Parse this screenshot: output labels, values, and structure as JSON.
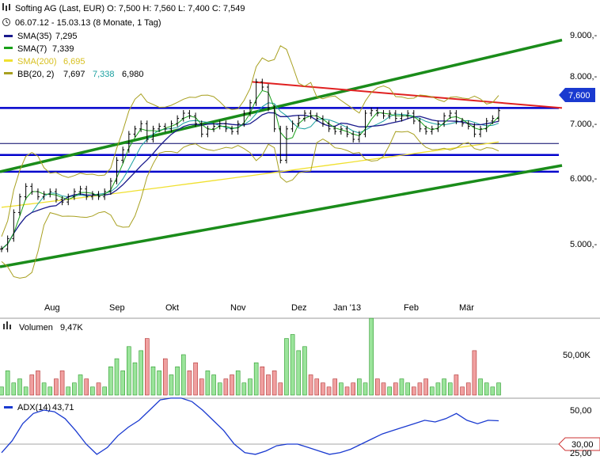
{
  "header": {
    "title_line": "Softing AG (Last, EUR)  O: 7,500  H: 7,560  L: 7,400  C: 7,549",
    "period_line": "06.07.12 - 15.03.13 (8 Monate, 1 Tag)"
  },
  "legend": {
    "sma35": {
      "label": "SMA(35)",
      "value": "7,295",
      "color": "#1a1a8c"
    },
    "sma7": {
      "label": "SMA(7)",
      "value": "7,339",
      "color": "#18a018"
    },
    "sma200": {
      "label": "SMA(200)",
      "value": "6,695",
      "color": "#f0e030"
    },
    "bb": {
      "label": "BB(20, 2)",
      "v1": "7,697",
      "v2": "7,338",
      "v3": "6,980",
      "color": "#a8a020",
      "mid_color": "#1aa0a0"
    }
  },
  "price_axis": {
    "labels": [
      "9.000,-",
      "8.000,-",
      "7.000,-",
      "6.000,-",
      "5.000,-"
    ]
  },
  "current_price_tag": "7,600",
  "time_axis": {
    "labels": [
      "Aug",
      "Sep",
      "Okt",
      "Nov",
      "Dez",
      "Jan '13",
      "Feb",
      "Mär"
    ]
  },
  "volume_panel": {
    "label": "Volumen",
    "value": "9,47K",
    "axis_label": "50,00K"
  },
  "adx_panel": {
    "label": "ADX(14)",
    "value": "43,71",
    "axis_labels": [
      "50,00",
      "30,00",
      "25,00"
    ]
  },
  "chart_data": {
    "type": "candlestick",
    "title": "Softing AG (Last, EUR)",
    "period": "06.07.12 - 15.03.13",
    "ohlc_last": {
      "open": 7.5,
      "high": 7.56,
      "low": 7.4,
      "close": 7.549
    },
    "y_ticks": [
      9.0,
      8.0,
      7.0,
      6.0,
      5.0
    ],
    "x_labels": [
      "Aug",
      "Sep",
      "Okt",
      "Nov",
      "Dez",
      "Jan '13",
      "Feb",
      "Mär"
    ],
    "approx_closes": [
      4.9,
      5.1,
      5.6,
      5.9,
      6.1,
      6.0,
      5.9,
      5.95,
      6.0,
      5.85,
      5.8,
      5.9,
      6.0,
      6.05,
      5.9,
      5.95,
      5.9,
      6.0,
      6.2,
      6.6,
      6.8,
      7.1,
      7.2,
      7.3,
      7.0,
      7.2,
      7.25,
      7.2,
      7.3,
      7.4,
      7.5,
      7.45,
      7.3,
      7.1,
      7.2,
      7.25,
      7.3,
      7.2,
      7.15,
      7.3,
      7.5,
      7.7,
      8.1,
      8.0,
      7.6,
      7.2,
      6.6,
      7.2,
      7.3,
      7.4,
      7.5,
      7.45,
      7.4,
      7.3,
      7.2,
      7.15,
      7.2,
      7.1,
      7.0,
      7.1,
      7.5,
      7.55,
      7.5,
      7.45,
      7.5,
      7.4,
      7.45,
      7.5,
      7.35,
      7.2,
      7.15,
      7.2,
      7.3,
      7.45,
      7.5,
      7.35,
      7.3,
      7.25,
      7.1,
      7.2,
      7.35,
      7.4,
      7.549
    ],
    "horizontal_lines": [
      {
        "value": 7.6,
        "color": "#0000cc"
      },
      {
        "value": 6.92,
        "color": "#000066"
      },
      {
        "value": 6.7,
        "color": "#0000cc"
      },
      {
        "value": 6.38,
        "color": "#0000cc"
      }
    ],
    "trendlines": [
      {
        "color": "#1a8c1a",
        "from": [
          "Jul",
          6.38
        ],
        "to": [
          "Mär",
          8.9
        ]
      },
      {
        "color": "#1a8c1a",
        "from": [
          "Jul",
          4.56
        ],
        "to": [
          "Mär",
          6.5
        ]
      },
      {
        "color": "#e02020",
        "from": [
          "Nov",
          8.1
        ],
        "to": [
          "Mär",
          7.6
        ]
      }
    ],
    "volume_approx": [
      2,
      6,
      3,
      4,
      2,
      5,
      6,
      3,
      2,
      4,
      6,
      2,
      3,
      5,
      4,
      2,
      3,
      2,
      7,
      9,
      6,
      12,
      8,
      11,
      14,
      7,
      6,
      9,
      5,
      7,
      10,
      6,
      8,
      4,
      6,
      5,
      3,
      4,
      5,
      6,
      3,
      4,
      8,
      7,
      5,
      6,
      3,
      14,
      15,
      11,
      12,
      5,
      4,
      3,
      2,
      4,
      3,
      2,
      3,
      4,
      3,
      19,
      4,
      3,
      2,
      3,
      4,
      3,
      2,
      3,
      4,
      2,
      3,
      4,
      3,
      5,
      2,
      3,
      11,
      4,
      3,
      2,
      3
    ],
    "adx_approx": [
      25,
      32,
      42,
      48,
      50,
      49,
      45,
      38,
      30,
      24,
      28,
      35,
      40,
      44,
      50,
      56,
      57,
      57,
      55,
      50,
      44,
      38,
      30,
      25,
      24,
      26,
      29,
      30,
      30,
      28,
      26,
      24,
      25,
      27,
      30,
      33,
      36,
      38,
      40,
      42,
      44,
      43,
      45,
      48,
      44,
      42,
      44,
      43.7
    ]
  }
}
